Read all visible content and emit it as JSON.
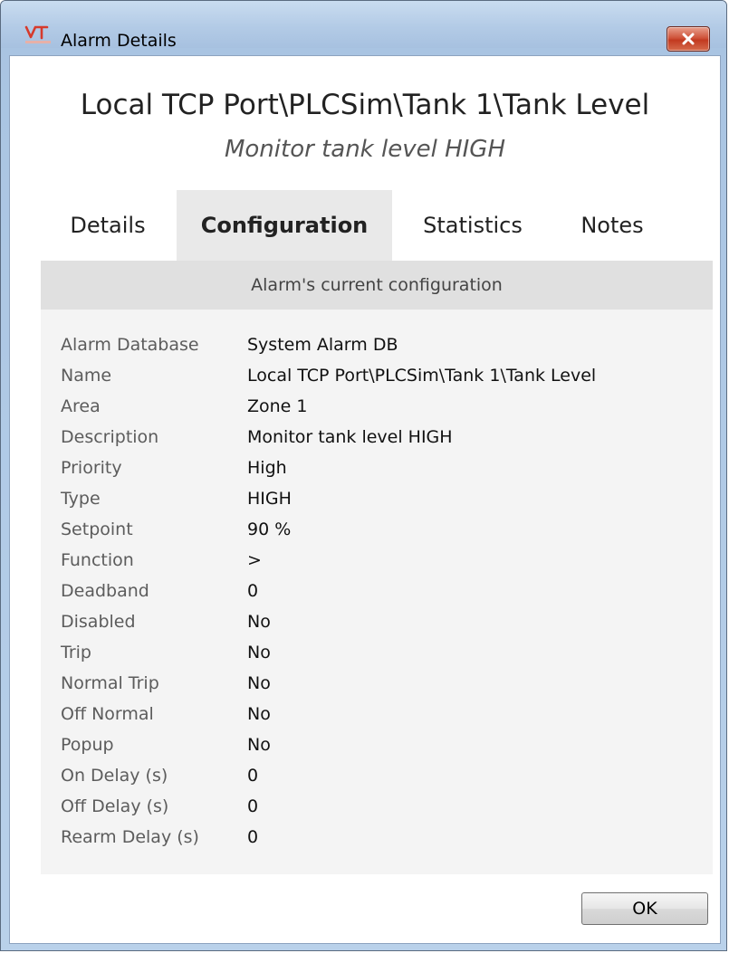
{
  "window": {
    "title": "Alarm Details",
    "close_icon": "close-icon",
    "app_icon": "vt-logo-icon"
  },
  "header": {
    "title": "Local TCP Port\\PLCSim\\Tank 1\\Tank Level",
    "subtitle": "Monitor tank level HIGH"
  },
  "tabs": [
    {
      "label": "Details",
      "active": false
    },
    {
      "label": "Configuration",
      "active": true
    },
    {
      "label": "Statistics",
      "active": false
    },
    {
      "label": "Notes",
      "active": false
    }
  ],
  "panel": {
    "header": "Alarm's current configuration",
    "rows": [
      {
        "key": "Alarm Database",
        "value": "System Alarm DB"
      },
      {
        "key": "Name",
        "value": "Local TCP Port\\PLCSim\\Tank 1\\Tank Level"
      },
      {
        "key": "Area",
        "value": "Zone 1"
      },
      {
        "key": "Description",
        "value": "Monitor tank level HIGH"
      },
      {
        "key": "Priority",
        "value": "High"
      },
      {
        "key": "Type",
        "value": "HIGH"
      },
      {
        "key": "Setpoint",
        "value": "90 %"
      },
      {
        "key": "Function",
        "value": ">"
      },
      {
        "key": "Deadband",
        "value": "0"
      },
      {
        "key": "Disabled",
        "value": "No"
      },
      {
        "key": "Trip",
        "value": "No"
      },
      {
        "key": "Normal Trip",
        "value": "No"
      },
      {
        "key": "Off Normal",
        "value": "No"
      },
      {
        "key": "Popup",
        "value": "No"
      },
      {
        "key": "On Delay (s)",
        "value": "0"
      },
      {
        "key": "Off Delay (s)",
        "value": "0"
      },
      {
        "key": "Rearm Delay (s)",
        "value": "0"
      }
    ]
  },
  "footer": {
    "ok_label": "OK"
  },
  "colors": {
    "active_tab_bg": "#e9e9e9",
    "panel_bg": "#f4f4f4",
    "panel_header_bg": "#e0e0e0",
    "close_button": "#c9442a",
    "logo_red": "#d63a2c"
  }
}
